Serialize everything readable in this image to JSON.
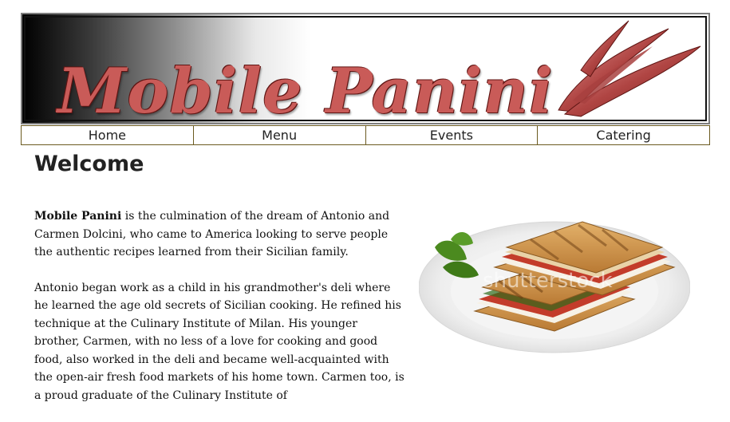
{
  "banner": {
    "logo_text": "Mobile Panini",
    "colors": {
      "logo": "#c95b58",
      "gradient_dark": "#000000",
      "gradient_light": "#ffffff"
    }
  },
  "nav": {
    "items": [
      "Home",
      "Menu",
      "Events",
      "Catering"
    ]
  },
  "main": {
    "title": "Welcome",
    "p1_bold": "Mobile Panini",
    "p1_rest": " is the culmination of the dream of Antonio and Carmen Dolcini, who came to America looking to serve people the authentic recipes learned from their Sicilian family.",
    "p2": "Antonio began work as a child in his grandmother's deli where he learned the age old secrets of Sicilian cooking. He refined his technique at the Culinary Institute of Milan. His younger brother, Carmen, with no less of a love for cooking and good food, also worked in the deli and became well-acquainted with the open-air fresh food markets of his home town. Carmen too, is a proud graduate of the Culinary Institute of",
    "photo_watermark": "shutterstock"
  }
}
